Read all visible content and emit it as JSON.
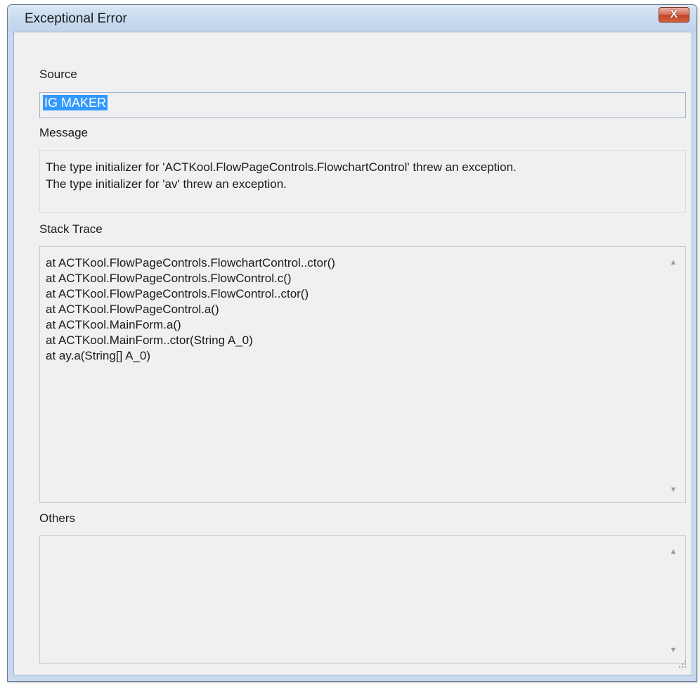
{
  "window": {
    "title": "Exceptional Error",
    "close_glyph": "X"
  },
  "source": {
    "label": "Source",
    "value": "IG MAKER"
  },
  "message": {
    "label": "Message",
    "lines": [
      "The type initializer for 'ACTKool.FlowPageControls.FlowchartControl' threw an exception.",
      "The type initializer for 'av' threw an exception."
    ]
  },
  "stack_trace": {
    "label": "Stack Trace",
    "text": "at ACTKool.FlowPageControls.FlowchartControl..ctor()\nat ACTKool.FlowPageControls.FlowControl.c()\nat ACTKool.FlowPageControls.FlowControl..ctor()\nat ACTKool.FlowPageControl.a()\nat ACTKool.MainForm.a()\nat ACTKool.MainForm..ctor(String A_0)\nat ay.a(String[] A_0)"
  },
  "others": {
    "label": "Others",
    "text": ""
  },
  "icons": {
    "close": "close-icon",
    "scroll_up": "chevron-up-icon",
    "scroll_down": "chevron-down-icon",
    "resize": "resize-grip-icon"
  },
  "colors": {
    "close_button": "#c2462a",
    "selection": "#3399ff",
    "client_background": "#f0f0f0"
  }
}
